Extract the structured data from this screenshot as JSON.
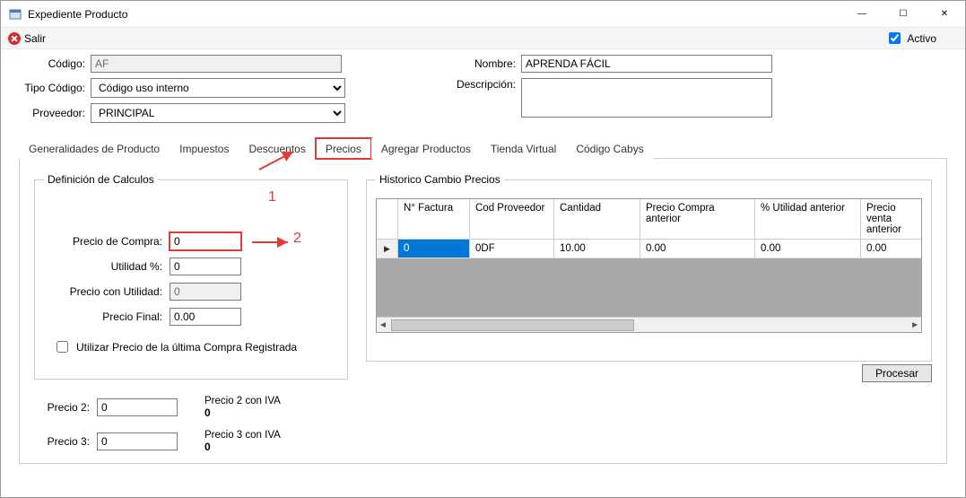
{
  "window": {
    "title": "Expediente Producto",
    "minimize": "—",
    "maximize": "☐",
    "close": "✕"
  },
  "toolbar": {
    "exit_label": "Salir",
    "active_label": "Activo",
    "active_checked": true
  },
  "fields": {
    "codigo_label": "Código:",
    "codigo_value": "AF",
    "tipo_label": "Tipo Código:",
    "tipo_value": "Código uso interno",
    "proveedor_label": "Proveedor:",
    "proveedor_value": "PRINCIPAL",
    "nombre_label": "Nombre:",
    "nombre_value": "APRENDA FÁCIL",
    "descripcion_label": "Descripción:",
    "descripcion_value": ""
  },
  "tabs": {
    "items": [
      "Generalidades de Producto",
      "Impuestos",
      "Descuentos",
      "Precios",
      "Agregar Productos",
      "Tienda Virtual",
      "Código Cabys"
    ],
    "active_index": 3
  },
  "calc": {
    "legend": "Definición de Calculos",
    "precio_compra_label": "Precio de Compra:",
    "precio_compra": "0",
    "utilidad_label": "Utilidad %:",
    "utilidad": "0",
    "precio_util_label": "Precio con Utilidad:",
    "precio_util": "0",
    "precio_final_label": "Precio Final:",
    "precio_final": "0.00",
    "usar_ultima_label": "Utilizar Precio de la última Compra Registrada",
    "usar_ultima": false
  },
  "extra_prices": {
    "p2_label": "Precio 2:",
    "p2": "0",
    "p2iva_label": "Precio 2 con IVA",
    "p2iva": "0",
    "p3_label": "Precio 3:",
    "p3": "0",
    "p3iva_label": "Precio 3 con IVA",
    "p3iva": "0"
  },
  "history": {
    "legend": "Historico Cambio Precios",
    "headers": {
      "factura": "N° Factura",
      "cod_prov": "Cod Proveedor",
      "cantidad": "Cantidad",
      "precio_compra_ant": "Precio Compra anterior",
      "utilidad_ant": "% Utilidad anterior",
      "precio_venta_ant": "Precio venta anterior"
    },
    "rows": [
      {
        "factura": "0",
        "cod_prov": "0DF",
        "cantidad": "10.00",
        "precio_compra_ant": "0.00",
        "utilidad_ant": "0.00",
        "precio_venta_ant": "0.00"
      }
    ]
  },
  "actions": {
    "procesar": "Procesar"
  },
  "annotations": {
    "n1": "1",
    "n2": "2"
  }
}
